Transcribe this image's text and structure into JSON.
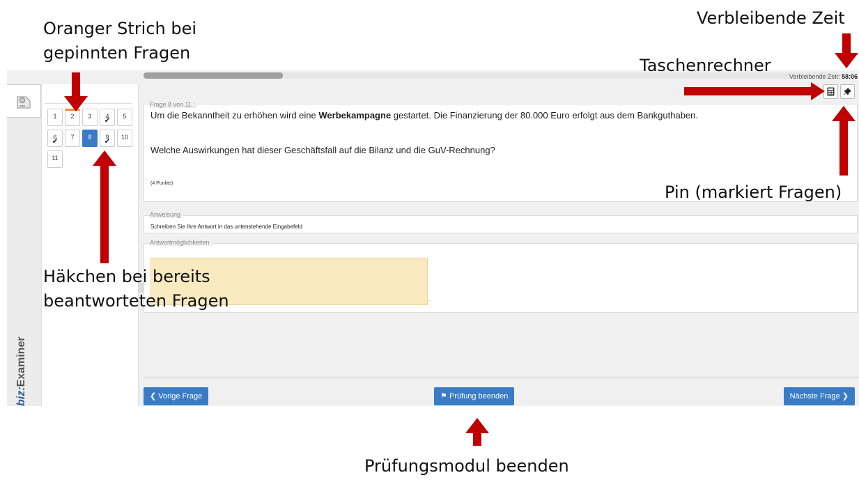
{
  "annotations": {
    "pinned_line": [
      "Oranger Strich bei",
      "gepinnten Fragen"
    ],
    "remaining_time": "Verbleibende Zeit",
    "calculator": "Taschenrechner",
    "pin": "Pin (markiert Fragen)",
    "answered_check": [
      "Häkchen bei bereits",
      "beantworteten Fragen"
    ],
    "end_module": "Prüfungsmodul beenden"
  },
  "header": {
    "progress_fraction": 0.2,
    "timer_label": "Verbleibende Zeit:",
    "timer_value": "58:06"
  },
  "brand": {
    "prefix": "biz:",
    "name": "Examiner"
  },
  "question_nav": [
    {
      "n": "1",
      "answered": false,
      "pinned": false,
      "current": false
    },
    {
      "n": "2",
      "answered": false,
      "pinned": true,
      "current": false
    },
    {
      "n": "3",
      "answered": false,
      "pinned": false,
      "current": false
    },
    {
      "n": "4",
      "answered": true,
      "pinned": false,
      "current": false
    },
    {
      "n": "5",
      "answered": false,
      "pinned": false,
      "current": false
    },
    {
      "n": "6",
      "answered": true,
      "pinned": false,
      "current": false
    },
    {
      "n": "7",
      "answered": false,
      "pinned": false,
      "current": false
    },
    {
      "n": "8",
      "answered": false,
      "pinned": false,
      "current": true
    },
    {
      "n": "9",
      "answered": true,
      "pinned": false,
      "current": false
    },
    {
      "n": "10",
      "answered": false,
      "pinned": false,
      "current": false
    },
    {
      "n": "11",
      "answered": false,
      "pinned": false,
      "current": false
    }
  ],
  "question": {
    "legend": "Frage 8 von 11 :",
    "text1_before": "Um die Bekanntheit zu erhöhen wird eine ",
    "text1_bold": "Werbekampagne",
    "text1_after": " gestartet. Die Finanzierung der 80.000 Euro erfolgt aus dem Bankguthaben.",
    "text2": "Welche Auswirkungen hat dieser Geschäftsfall auf die Bilanz und die GuV-Rechnung?",
    "points": "(4 Punkte)"
  },
  "instruction": {
    "legend": "Anweisung",
    "text": "Schreiben Sie Ihre Antwort in das untenstehende Eingabefeld"
  },
  "answer": {
    "legend": "Antwortmöglichkeiten",
    "value": ""
  },
  "footer": {
    "prev_label": "Vorige Frage",
    "finish_label": "Prüfung beenden",
    "next_label": "Nächste Frage"
  },
  "icons": {
    "calculator": "calculator-icon",
    "pin": "pin-icon",
    "prev": "chevron-left-icon",
    "next": "chevron-right-icon",
    "finish": "flag-icon"
  },
  "colors": {
    "primary": "#3a7bc6",
    "pinned_marker": "#f0892f",
    "answer_bg": "#faeabf",
    "annotation_arrow": "#c00000"
  }
}
